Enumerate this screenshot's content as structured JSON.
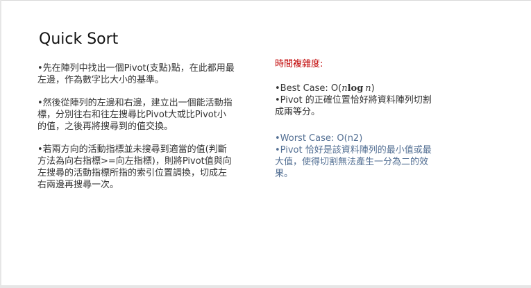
{
  "slide": {
    "title": "Quick Sort",
    "left_bullets": [
      "•先在陣列中找出一個Pivot(支點)點，在此都用最左邊，作為數字比大小的基準。",
      "•然後從陣列的左邊和右邊，建立出一個能活動指標，分別往右和往左搜尋比Pivot大或比Pivot小的值，之後再將搜尋到的值交換。",
      "•若兩方向的活動指標並未搜尋到適當的值(判斷方法為向右指標>=向左指標)，則將Pivot值與向左搜尋的活動指標所指的索引位置調換，切成左右兩邊再搜尋一次。"
    ],
    "complexity_heading": "時間複雜度:",
    "best_case": {
      "label": "•Best Case: O(",
      "math_n": "n",
      "math_log": "log",
      "math_n2": "n",
      "close": ")",
      "description": "•Pivot 的正確位置恰好將資料陣列切割成兩等分。"
    },
    "worst_case": {
      "label": "•Worst Case: O(n2)",
      "description": "•Pivot 恰好是該資料陣列的最小值或最大值，使得切割無法產生一分為二的效果。"
    }
  },
  "colors": {
    "heading_red": "#c00000",
    "worst_blue": "#536f93",
    "body_text": "#333333"
  }
}
